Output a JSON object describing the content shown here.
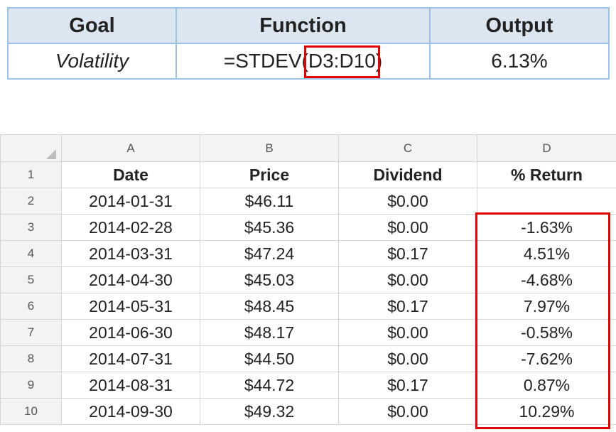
{
  "summary": {
    "headers": [
      "Goal",
      "Function",
      "Output"
    ],
    "goal": "Volatility",
    "function_prefix": "=STDEV(",
    "function_range": "D3:D10",
    "function_suffix": ")",
    "output": "6.13%"
  },
  "sheet": {
    "columns": [
      "A",
      "B",
      "C",
      "D"
    ],
    "row_numbers": [
      "1",
      "2",
      "3",
      "4",
      "5",
      "6",
      "7",
      "8",
      "9",
      "10"
    ],
    "header_row": [
      "Date",
      "Price",
      "Dividend",
      "% Return"
    ],
    "rows": [
      [
        "2014-01-31",
        "$46.11",
        "$0.00",
        ""
      ],
      [
        "2014-02-28",
        "$45.36",
        "$0.00",
        "-1.63%"
      ],
      [
        "2014-03-31",
        "$47.24",
        "$0.17",
        "4.51%"
      ],
      [
        "2014-04-30",
        "$45.03",
        "$0.00",
        "-4.68%"
      ],
      [
        "2014-05-31",
        "$48.45",
        "$0.17",
        "7.97%"
      ],
      [
        "2014-06-30",
        "$48.17",
        "$0.00",
        "-0.58%"
      ],
      [
        "2014-07-31",
        "$44.50",
        "$0.00",
        "-7.62%"
      ],
      [
        "2014-08-31",
        "$44.72",
        "$0.17",
        "0.87%"
      ],
      [
        "2014-09-30",
        "$49.32",
        "$0.00",
        "10.29%"
      ]
    ]
  },
  "colors": {
    "highlight": "#e00000",
    "summary_header_bg": "#dce6f1",
    "summary_border": "#9cc2e5",
    "sheet_header_bg": "#f3f3f3"
  }
}
